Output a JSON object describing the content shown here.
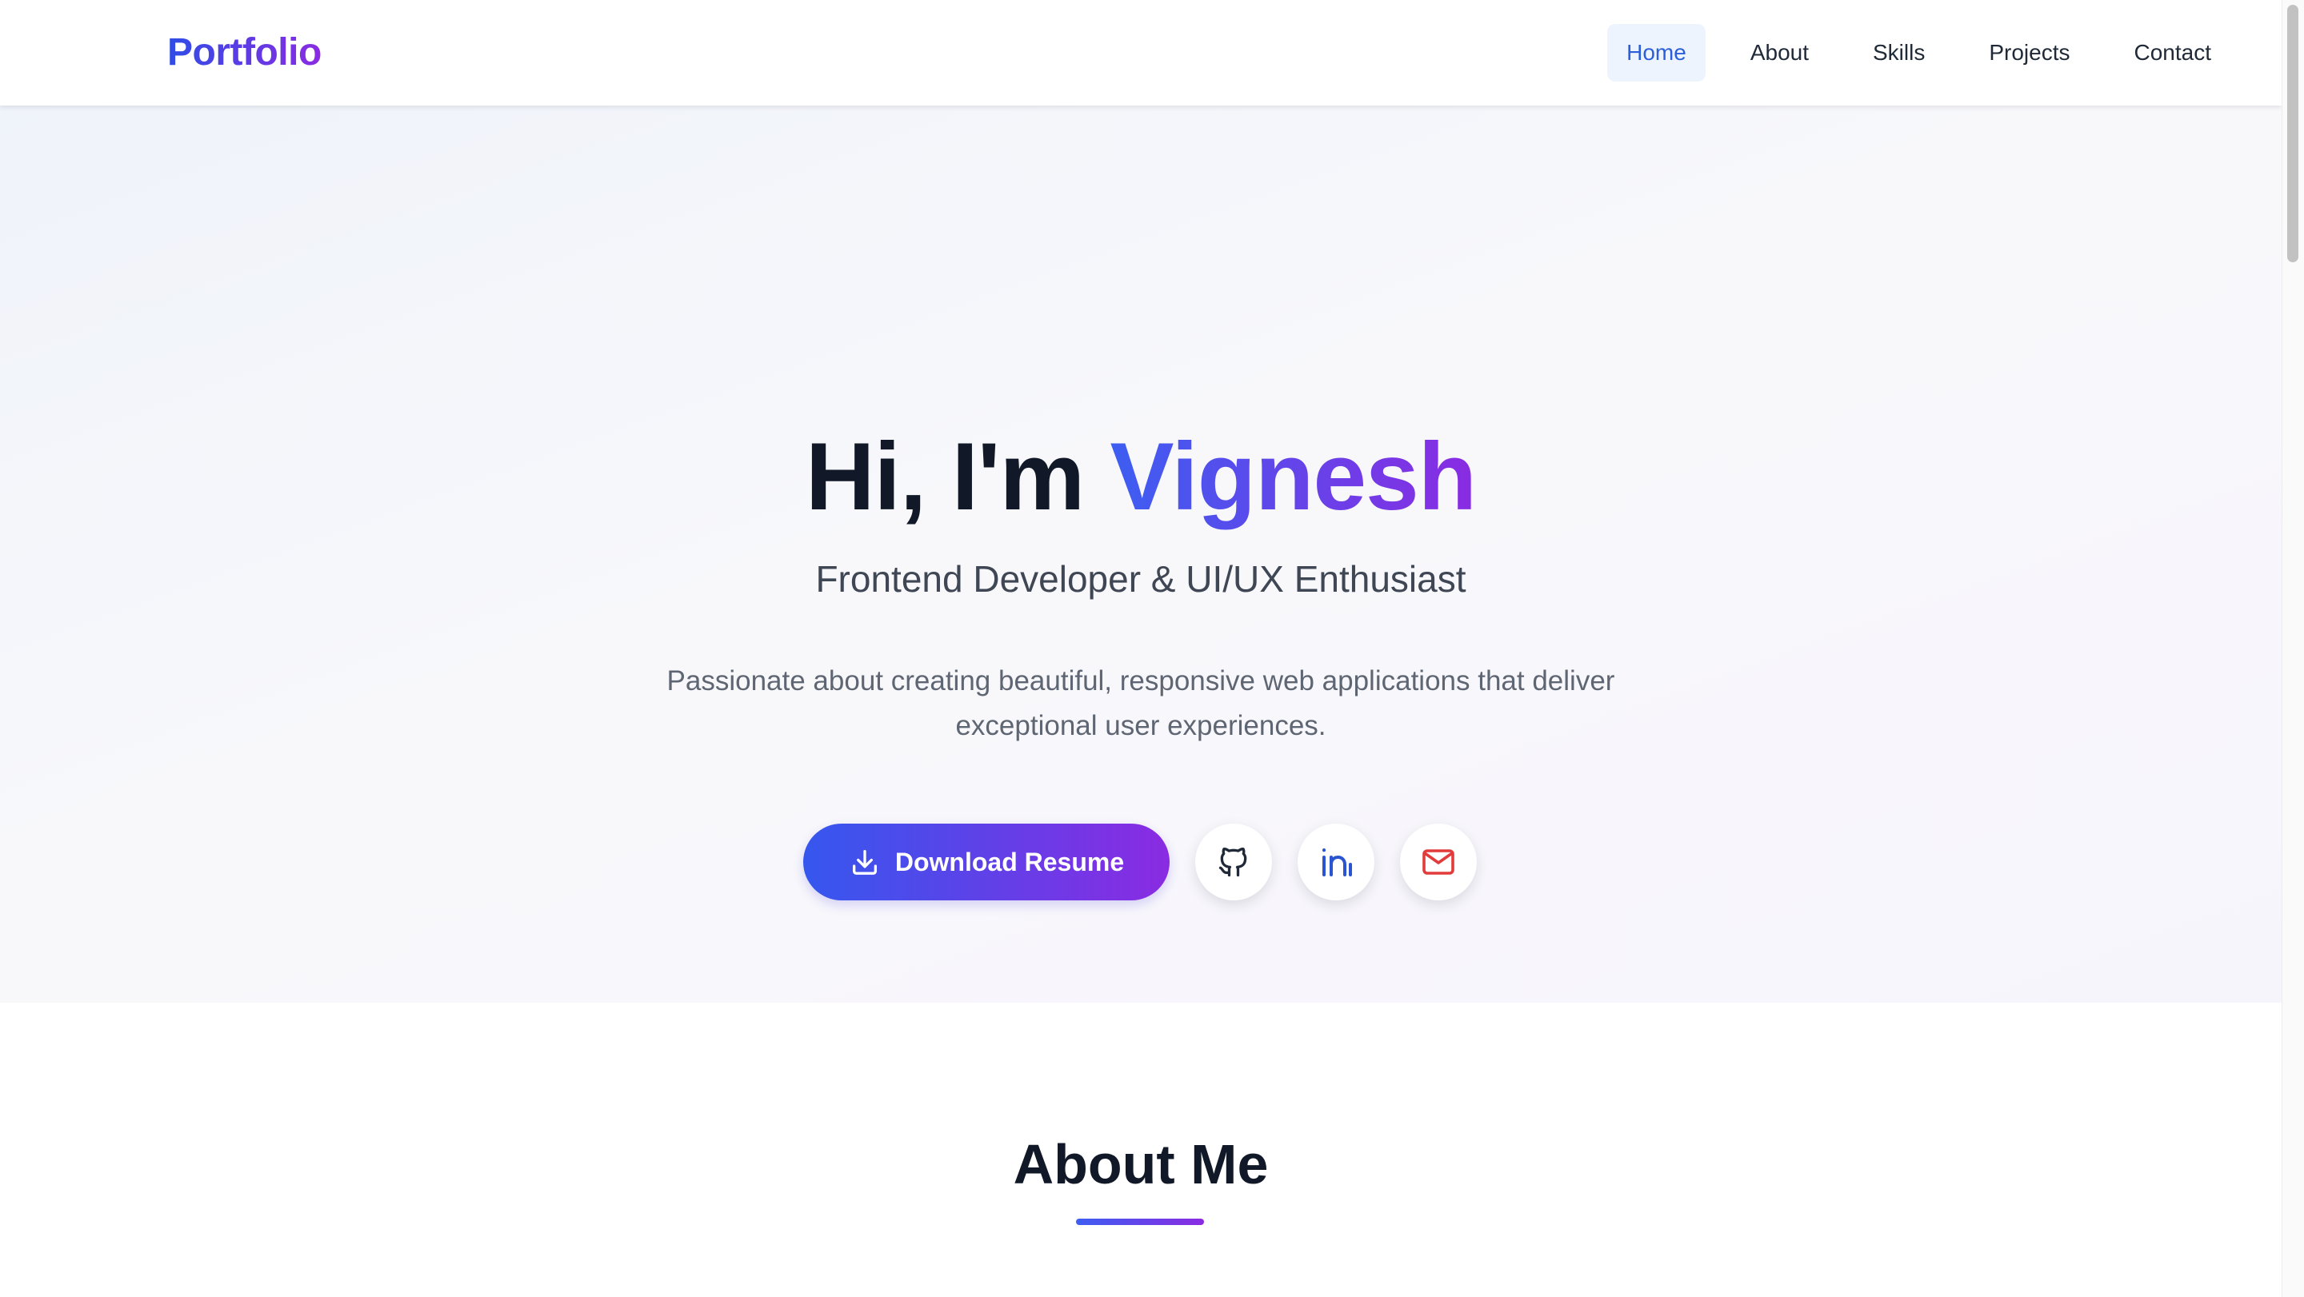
{
  "nav": {
    "logo": "Portfolio",
    "links": [
      "Home",
      "About",
      "Skills",
      "Projects",
      "Contact"
    ],
    "active_link": "Home"
  },
  "hero": {
    "greeting": "Hi, I'm",
    "name": "Vignesh",
    "subtitle": "Frontend Developer & UI/UX Enthusiast",
    "description": "Passionate about creating beautiful, responsive web applications that deliver exceptional user experiences.",
    "download_label": "Download Resume",
    "socials": [
      {
        "icon": "github-icon",
        "color": "#1f2937"
      },
      {
        "icon": "linkedin-icon",
        "color": "#2b54d0"
      },
      {
        "icon": "mail-icon",
        "color": "#e23b3b"
      }
    ]
  },
  "about": {
    "heading": "About Me"
  },
  "colors": {
    "accent_start": "#3d5ef1",
    "accent_end": "#8a2be2",
    "active_nav_bg": "#eef4fd",
    "active_nav_text": "#2b5ed8"
  }
}
